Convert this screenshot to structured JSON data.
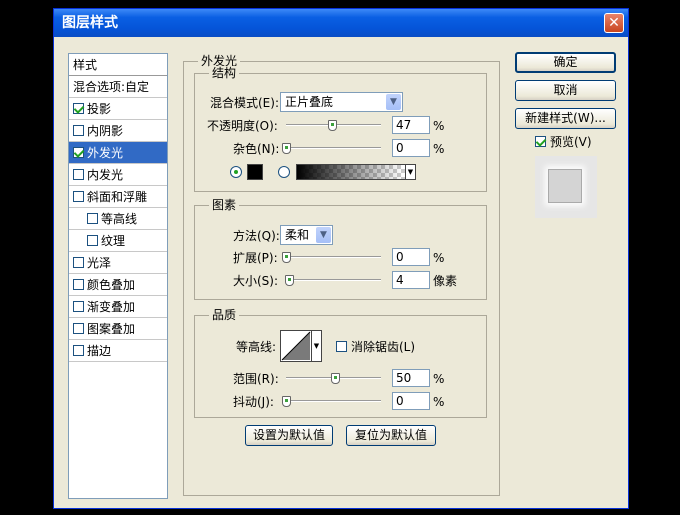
{
  "window": {
    "title": "图层样式",
    "close_glyph": "✕"
  },
  "sidebar": {
    "header": "样式",
    "blend_options": "混合选项:自定",
    "items": [
      {
        "label": "投影",
        "checked": true,
        "sub": false,
        "selected": false
      },
      {
        "label": "内阴影",
        "checked": false,
        "sub": false,
        "selected": false
      },
      {
        "label": "外发光",
        "checked": true,
        "sub": false,
        "selected": true
      },
      {
        "label": "内发光",
        "checked": false,
        "sub": false,
        "selected": false
      },
      {
        "label": "斜面和浮雕",
        "checked": false,
        "sub": false,
        "selected": false
      },
      {
        "label": "等高线",
        "checked": false,
        "sub": true,
        "selected": false
      },
      {
        "label": "纹理",
        "checked": false,
        "sub": true,
        "selected": false
      },
      {
        "label": "光泽",
        "checked": false,
        "sub": false,
        "selected": false
      },
      {
        "label": "颜色叠加",
        "checked": false,
        "sub": false,
        "selected": false
      },
      {
        "label": "渐变叠加",
        "checked": false,
        "sub": false,
        "selected": false
      },
      {
        "label": "图案叠加",
        "checked": false,
        "sub": false,
        "selected": false
      },
      {
        "label": "描边",
        "checked": false,
        "sub": false,
        "selected": false
      }
    ]
  },
  "panel": {
    "title": "外发光",
    "structure": {
      "title": "结构",
      "blend_mode_label": "混合模式(E):",
      "blend_mode_value": "正片叠底",
      "opacity_label": "不透明度(O):",
      "opacity_value": "47",
      "opacity_unit": "%",
      "noise_label": "杂色(N):",
      "noise_value": "0",
      "noise_unit": "%",
      "color_radio_selected": "solid",
      "glow_color": "#000000"
    },
    "elements": {
      "title": "图素",
      "technique_label": "方法(Q):",
      "technique_value": "柔和",
      "spread_label": "扩展(P):",
      "spread_value": "0",
      "spread_unit": "%",
      "size_label": "大小(S):",
      "size_value": "4",
      "size_unit": "像素"
    },
    "quality": {
      "title": "品质",
      "contour_label": "等高线:",
      "antialias_label": "消除锯齿(L)",
      "antialias_checked": false,
      "range_label": "范围(R):",
      "range_value": "50",
      "range_unit": "%",
      "jitter_label": "抖动(J):",
      "jitter_value": "0",
      "jitter_unit": "%"
    },
    "make_default": "设置为默认值",
    "reset_default": "复位为默认值"
  },
  "buttons": {
    "ok": "确定",
    "cancel": "取消",
    "new_style": "新建样式(W)...",
    "preview_label": "预览(V)",
    "preview_checked": true
  }
}
